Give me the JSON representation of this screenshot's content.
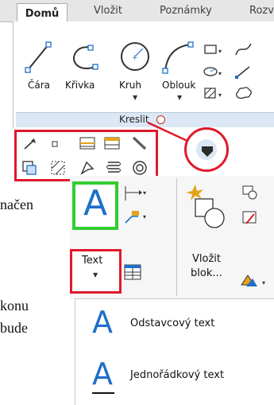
{
  "tabs": [
    {
      "label": "Domů"
    },
    {
      "label": "Vložit"
    },
    {
      "label": "Poznámky"
    },
    {
      "label": "Rozv"
    }
  ],
  "draw_panel": {
    "tools": {
      "line": "Čára",
      "curve": "Křivka",
      "circle": "Kruh",
      "arc": "Oblouk"
    },
    "panel_title": "Kreslit"
  },
  "body_text": {
    "line1": "načen",
    "line2": "konu",
    "line3": "bude"
  },
  "annotate_panel": {
    "text_button": "Text",
    "insert_block_line1": "Vložit",
    "insert_block_line2": "blok..."
  },
  "text_menu": {
    "items": [
      {
        "label": "Odstavcový text"
      },
      {
        "label": "Jednořádkový text"
      }
    ]
  },
  "colors": {
    "highlight_red": "#e0192a",
    "highlight_green": "#33cc33",
    "icon_blue": "#1e6fc8",
    "panel_bar": "#dbe7f4"
  }
}
